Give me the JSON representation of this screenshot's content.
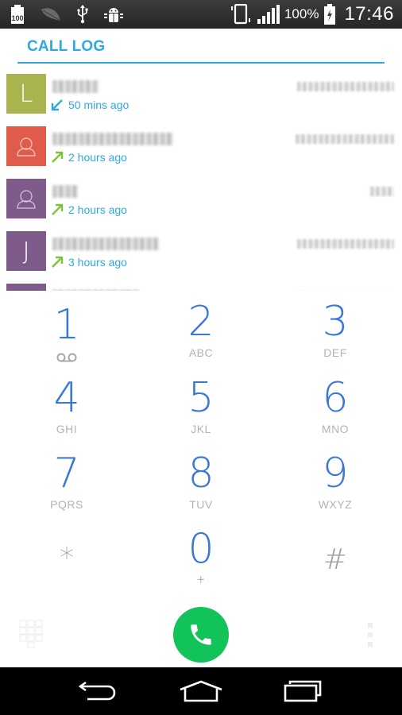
{
  "status_bar": {
    "left_icons": [
      "battery-100-notification-icon",
      "leaf-icon",
      "usb-icon",
      "android-debug-icon"
    ],
    "battery_notice_label": "100",
    "right_icons": [
      "vibrate-icon",
      "signal-icon",
      "battery-charging-icon"
    ],
    "battery_percent": "100%",
    "time": "17:46"
  },
  "header": {
    "title": "CALL LOG"
  },
  "call_log": {
    "items": [
      {
        "avatar_letter": "L",
        "avatar_type": "letter",
        "avatar_color": "#aab44e",
        "name": "[blurred]",
        "number": "[blurred]",
        "direction": "incoming",
        "time": "50 mins ago"
      },
      {
        "avatar_letter": "",
        "avatar_type": "person",
        "avatar_color": "#e05b4c",
        "name": "[blurred]",
        "number": "[blurred]",
        "direction": "outgoing",
        "time": "2 hours ago"
      },
      {
        "avatar_letter": "",
        "avatar_type": "person",
        "avatar_color": "#7e5b8a",
        "name": "[blurred]",
        "number": "[blurred]",
        "direction": "outgoing",
        "time": "2 hours ago"
      },
      {
        "avatar_letter": "J",
        "avatar_type": "letter",
        "avatar_color": "#7e5b8a",
        "name": "[blurred]",
        "number": "[blurred]",
        "direction": "outgoing",
        "time": "3 hours ago"
      },
      {
        "avatar_letter": "",
        "avatar_type": "letter",
        "avatar_color": "#7e5b8a",
        "name": "[blurred]",
        "number": "[blurred]",
        "direction": "",
        "time": ""
      }
    ]
  },
  "dialpad": {
    "keys": [
      {
        "digit": "1",
        "letters": "",
        "sub_icon": "voicemail-icon"
      },
      {
        "digit": "2",
        "letters": "ABC"
      },
      {
        "digit": "3",
        "letters": "DEF"
      },
      {
        "digit": "4",
        "letters": "GHI"
      },
      {
        "digit": "5",
        "letters": "JKL"
      },
      {
        "digit": "6",
        "letters": "MNO"
      },
      {
        "digit": "7",
        "letters": "PQRS"
      },
      {
        "digit": "8",
        "letters": "TUV"
      },
      {
        "digit": "9",
        "letters": "WXYZ"
      },
      {
        "digit": "*",
        "letters": ""
      },
      {
        "digit": "0",
        "letters": "+"
      },
      {
        "digit": "#",
        "letters": ""
      }
    ]
  },
  "actions": {
    "dialpad_toggle_icon": "dialpad-icon",
    "call_button_icon": "phone-icon",
    "overflow_icon": "more-vert-icon"
  },
  "nav_bar": {
    "buttons": [
      "back-icon",
      "home-icon",
      "recents-icon"
    ]
  },
  "colors": {
    "accent": "#2fa9dc",
    "digit": "#3a78d6",
    "call_green": "#12c35a",
    "incoming_arrow": "#2fa9dc",
    "outgoing_arrow": "#7dc43a"
  }
}
